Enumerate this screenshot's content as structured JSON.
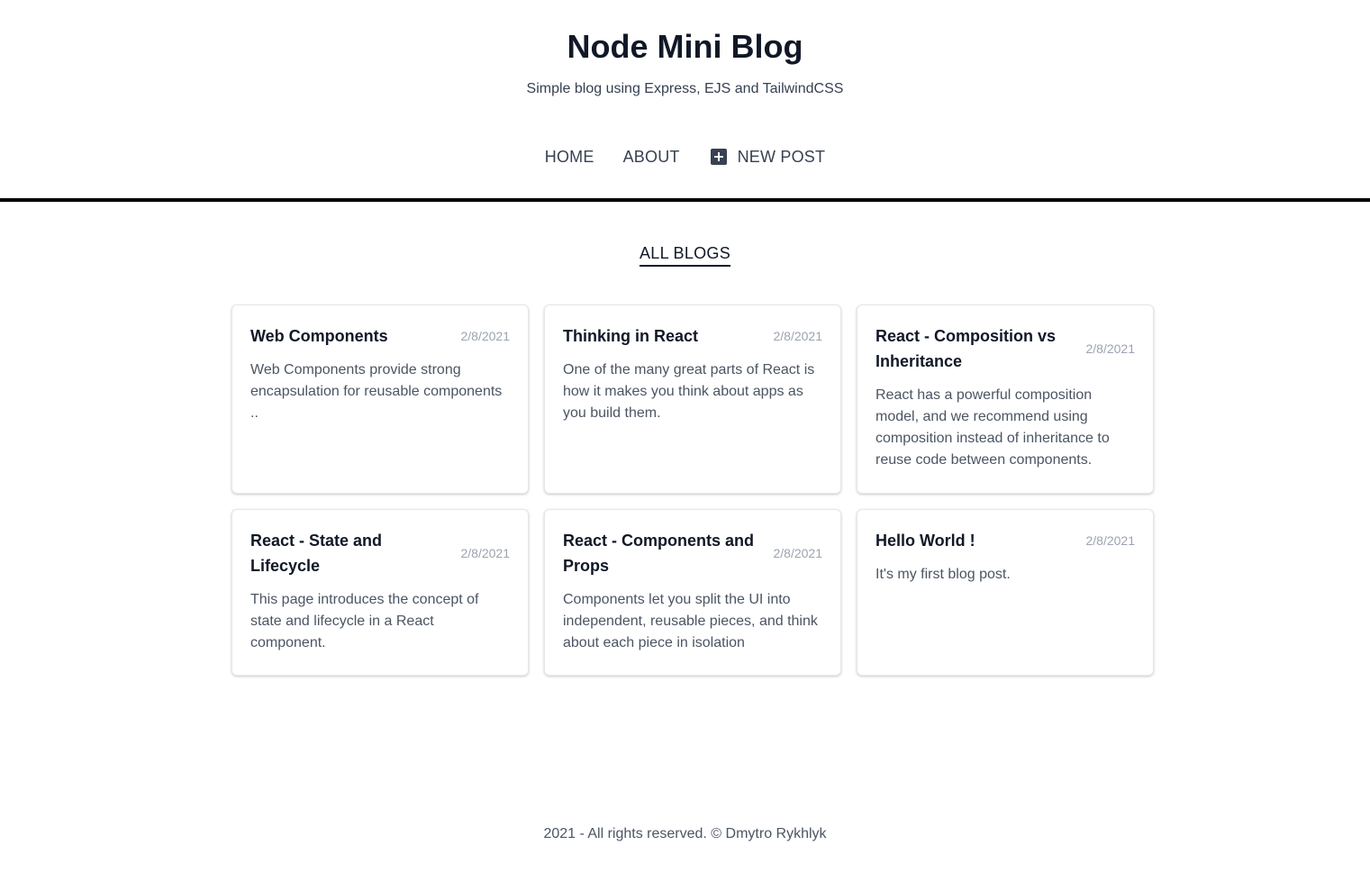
{
  "header": {
    "title": "Node Mini Blog",
    "subtitle": "Simple blog using Express, EJS and TailwindCSS"
  },
  "nav": {
    "home": "HOME",
    "about": "ABOUT",
    "new_post": "NEW POST",
    "new_post_icon": "plus-square-icon"
  },
  "section": {
    "heading": "ALL BLOGS"
  },
  "posts": [
    {
      "title": "Web Components",
      "date": "2/8/2021",
      "snippet": "Web Components provide strong encapsulation for reusable components .."
    },
    {
      "title": "Thinking in React",
      "date": "2/8/2021",
      "snippet": "One of the many great parts of React is how it makes you think about apps as you build them."
    },
    {
      "title": "React - Composition vs Inheritance",
      "date": "2/8/2021",
      "snippet": "React has a powerful composition model, and we recommend using composition instead of inheritance to reuse code between components."
    },
    {
      "title": "React - State and Lifecycle",
      "date": "2/8/2021",
      "snippet": "This page introduces the concept of state and lifecycle in a React component."
    },
    {
      "title": "React - Components and Props",
      "date": "2/8/2021",
      "snippet": "Components let you split the UI into independent, reusable pieces, and think about each piece in isolation"
    },
    {
      "title": "Hello World !",
      "date": "2/8/2021",
      "snippet": "It's my first blog post."
    }
  ],
  "footer": {
    "text": "2021 - All rights reserved. © Dmytro Rykhlyk"
  }
}
